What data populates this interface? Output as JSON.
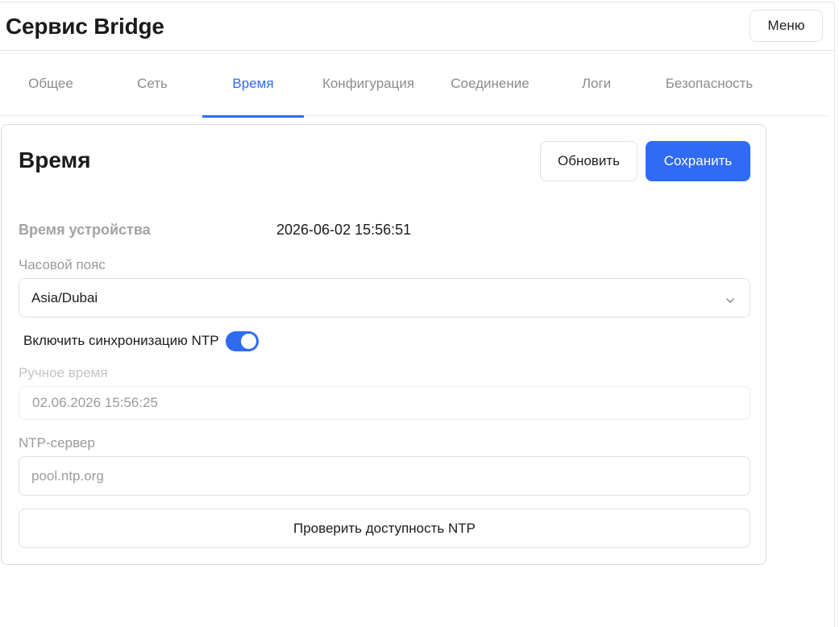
{
  "header": {
    "title": "Сервис Bridge",
    "menu_label": "Меню"
  },
  "tabs": [
    {
      "label": "Общее"
    },
    {
      "label": "Сеть"
    },
    {
      "label": "Время"
    },
    {
      "label": "Конфигурация"
    },
    {
      "label": "Соединение"
    },
    {
      "label": "Логи"
    },
    {
      "label": "Безопасность"
    }
  ],
  "active_tab": "Время",
  "card": {
    "title": "Время",
    "refresh_label": "Обновить",
    "save_label": "Сохранить",
    "device_time_label": "Время устройства",
    "device_time_value": "2026-06-02 15:56:51",
    "timezone_label": "Часовой пояс",
    "timezone_value": "Asia/Dubai",
    "ntp_sync_label": "Включить синхронизацию NTP",
    "ntp_sync_enabled": true,
    "manual_time_label": "Ручное время",
    "manual_time_value": "02.06.2026 15:56:25",
    "ntp_server_label": "NTP-сервер",
    "ntp_server_placeholder": "pool.ntp.org",
    "ntp_server_value": "",
    "check_ntp_label": "Проверить доступность NTP"
  },
  "icons": {
    "timezone_dropdown": "chevron-down-icon"
  },
  "colors": {
    "accent": "#2f6bf0",
    "save_button": "#2f6bf5"
  }
}
